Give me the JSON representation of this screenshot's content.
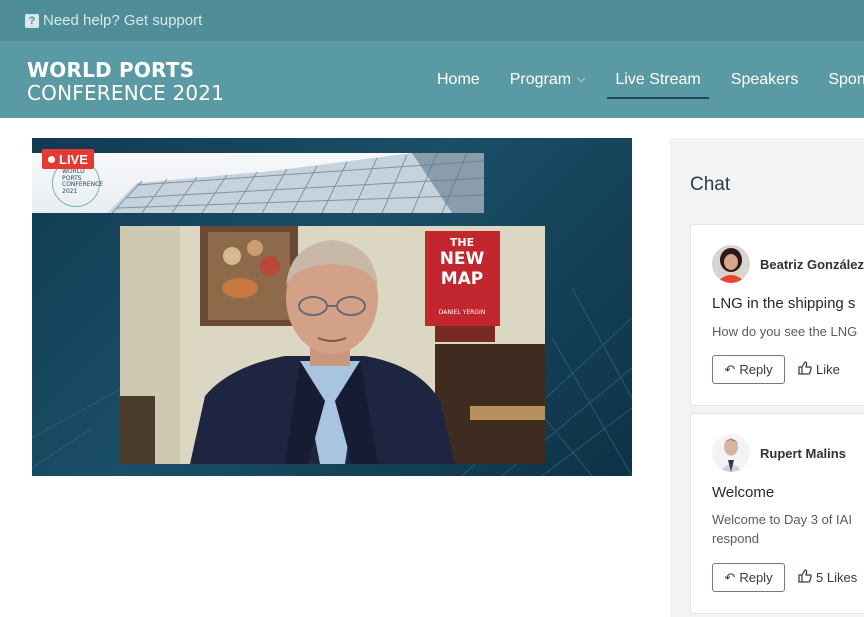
{
  "help_bar": {
    "icon": "question-square-icon",
    "text": "Need help? Get support"
  },
  "logo": {
    "line1": "WORLD PORTS",
    "line2": "CONFERENCE 2021"
  },
  "nav": {
    "items": [
      {
        "label": "Home"
      },
      {
        "label": "Program"
      },
      {
        "label": "Live Stream",
        "active": true
      },
      {
        "label": "Speakers"
      },
      {
        "label": "Spons"
      }
    ]
  },
  "video": {
    "live_badge": "LIVE",
    "conference_logo": [
      "WORLD",
      "PORTS",
      "CONFERENCE",
      "2021"
    ],
    "book": {
      "line1": "THE",
      "line2": "NEW",
      "line3": "MAP",
      "author": "DANIEL YERGIN"
    }
  },
  "chat": {
    "title": "Chat",
    "messages": [
      {
        "author": "Beatriz González",
        "title": "LNG in the shipping s",
        "body": [
          "How do you see the LNG"
        ],
        "reply_label": "Reply",
        "like_label": "Like"
      },
      {
        "author": "Rupert Malins",
        "title": "Welcome",
        "body": [
          "Welcome to Day 3 of IAI",
          "respond"
        ],
        "reply_label": "Reply",
        "like_label": "5 Likes"
      }
    ]
  },
  "colors": {
    "help_bar_bg": "#4f8e98",
    "nav_bg": "#5a9aa4",
    "live_red": "#e53935",
    "active_underline": "#1e4b57"
  }
}
